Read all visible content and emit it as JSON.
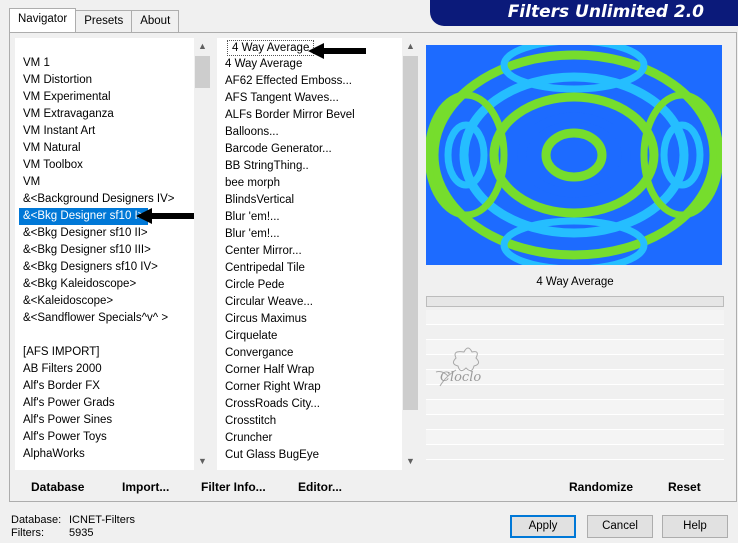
{
  "banner": {
    "title": "Filters Unlimited 2.0"
  },
  "tabs": [
    {
      "label": "Navigator"
    },
    {
      "label": "Presets"
    },
    {
      "label": "About"
    }
  ],
  "categories": {
    "items": [
      "VM 1",
      "VM Distortion",
      "VM Experimental",
      "VM Extravaganza",
      "VM Instant Art",
      "VM Natural",
      "VM Toolbox",
      "VM",
      "&<Background Designers IV>",
      "&<Bkg Designer sf10 I>",
      "&<Bkg Designer sf10 II>",
      "&<Bkg Designer sf10 III>",
      "&<Bkg Designers sf10 IV>",
      "&<Bkg Kaleidoscope>",
      "&<Kaleidoscope>",
      "&<Sandflower Specials^v^ >",
      "",
      "[AFS IMPORT]",
      "AB Filters 2000",
      "Alf's Border FX",
      "Alf's Power Grads",
      "Alf's Power Sines",
      "Alf's Power Toys",
      "AlphaWorks"
    ],
    "selected_index": 9
  },
  "filters": {
    "items": [
      "4 Way Average",
      "4 Way Average",
      "AF62 Effected Emboss...",
      "AFS Tangent Waves...",
      "ALFs Border Mirror Bevel",
      "Balloons...",
      "Barcode Generator...",
      "BB StringThing..",
      "bee morph",
      "BlindsVertical",
      "Blur 'em!...",
      "Blur 'em!...",
      "Center Mirror...",
      "Centripedal Tile",
      "Circle Pede",
      "Circular Weave...",
      "Circus Maximus",
      "Cirquelate",
      "Convergance",
      "Corner Half Wrap",
      "Corner Right Wrap",
      "CrossRoads City...",
      "Crosstitch",
      "Cruncher",
      "Cut Glass  BugEye"
    ],
    "highlighted_index": 0
  },
  "preview": {
    "filter_name": "4 Way Average",
    "progress": 0
  },
  "watermark": {
    "text": "Cloclo"
  },
  "toolbar": {
    "database": "Database",
    "import": "Import...",
    "filter_info": "Filter Info...",
    "editor": "Editor...",
    "randomize": "Randomize",
    "reset": "Reset"
  },
  "status": {
    "database_label": "Database:",
    "database_value": "ICNET-Filters",
    "filters_label": "Filters:",
    "filters_value": "5935"
  },
  "buttons": {
    "apply": "Apply",
    "cancel": "Cancel",
    "help": "Help"
  },
  "colors": {
    "banner": "#0b1a7a",
    "selection": "#0078d7",
    "preview_green": "#7ee81c",
    "preview_blue": "#1e6cff"
  }
}
